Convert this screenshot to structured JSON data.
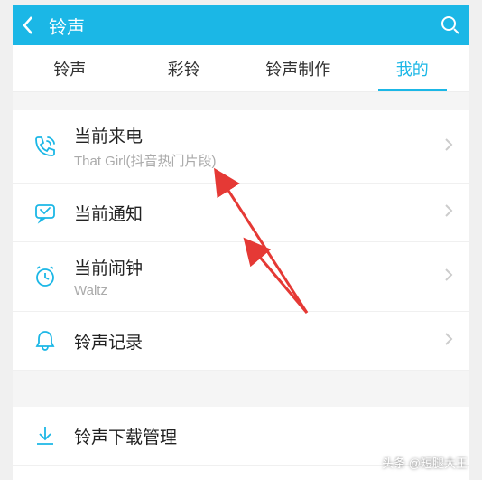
{
  "header": {
    "title": "铃声"
  },
  "tabs": [
    {
      "label": "铃声",
      "active": false
    },
    {
      "label": "彩铃",
      "active": false
    },
    {
      "label": "铃声制作",
      "active": false
    },
    {
      "label": "我的",
      "active": true
    }
  ],
  "items": [
    {
      "title": "当前来电",
      "subtitle": "That Girl(抖音热门片段)",
      "icon": "phone"
    },
    {
      "title": "当前通知",
      "subtitle": "",
      "icon": "message"
    },
    {
      "title": "当前闹钟",
      "subtitle": "Waltz",
      "icon": "clock"
    },
    {
      "title": "铃声记录",
      "subtitle": "",
      "icon": "bell"
    }
  ],
  "items2": [
    {
      "title": "铃声下载管理",
      "subtitle": "",
      "icon": "download"
    }
  ],
  "watermark": "头条 @短腿大王"
}
